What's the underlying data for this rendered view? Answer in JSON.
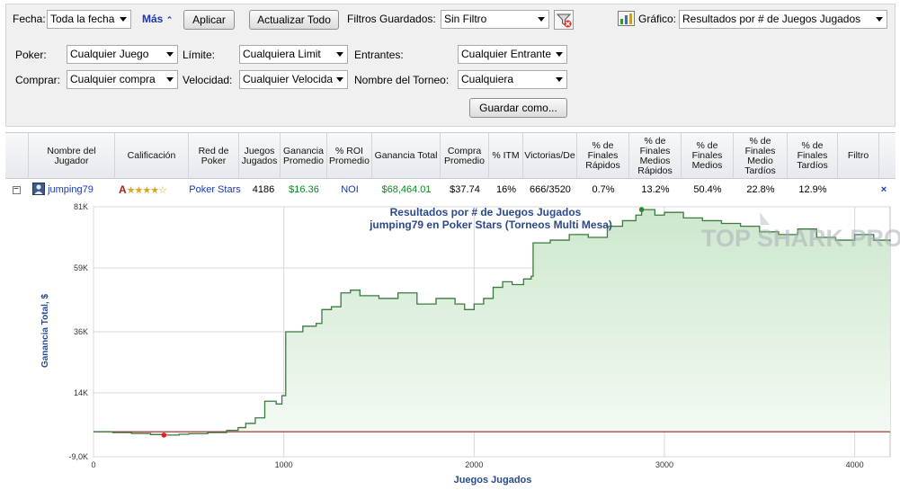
{
  "filters": {
    "fecha_label": "Fecha:",
    "fecha_value": "Toda la fecha",
    "mas_label": "Más",
    "aplicar_label": "Aplicar",
    "actualizar_label": "Actualizar Todo",
    "filtros_guardados_label": "Filtros Guardados:",
    "filtros_guardados_value": "Sin Filtro",
    "grafico_label": "Gráfico:",
    "grafico_value": "Resultados por # de Juegos Jugados",
    "poker_label": "Poker:",
    "poker_value": "Cualquier Juego",
    "limite_label": "Límite:",
    "limite_value": "Cualquiera Limit",
    "entrantes_label": "Entrantes:",
    "entrantes_value": "Cualquier Entrante",
    "comprar_label": "Comprar:",
    "comprar_value": "Cualquier compra",
    "velocidad_label": "Velocidad:",
    "velocidad_value": "Cualquier Velocida",
    "nombre_torneo_label": "Nombre del Torneo:",
    "nombre_torneo_value": "Cualquiera",
    "guardar_label": "Guardar como..."
  },
  "table": {
    "headers": {
      "nombre": "Nombre del Jugador",
      "calificacion": "Calificación",
      "red": "Red de Poker",
      "juegos": "Juegos Jugados",
      "ganancia_prom": "Ganancia Promedio",
      "roi": "% ROI Promedio",
      "ganancia_total": "Ganancia Total",
      "compra": "Compra Promedio",
      "itm": "% ITM",
      "victorias": "Victorias/De",
      "fin_rapidos": "% de Finales Rápidos",
      "fin_medios_rapidos": "% de Finales Medios Rápidos",
      "fin_medios": "% de Finales Medios",
      "fin_medio_tardios": "% de Finales Medio Tardíos",
      "fin_tardios": "% de Finales Tardíos",
      "filtro": "Filtro"
    },
    "row": {
      "player": "jumping79",
      "grade": "A",
      "stars": "★★★★☆",
      "network": "Poker Stars",
      "games": "4186",
      "avg_profit": "$16.36",
      "roi": "NOI",
      "total_profit": "$68,464.01",
      "avg_buyin": "$37.74",
      "itm": "16%",
      "wins": "666/3520",
      "fin_rapidos": "0.7%",
      "fin_medios_rapidos": "13.2%",
      "fin_medios": "50.4%",
      "fin_medio_tardios": "22.8%",
      "fin_tardios": "12.9%",
      "remove": "×",
      "collapse": "−"
    }
  },
  "chart_data": {
    "type": "area",
    "title": "Resultados por # de Juegos Jugados",
    "subtitle": "jumping79 en Poker Stars (Torneos Multi Mesa)",
    "xlabel": "Juegos Jugados",
    "ylabel": "Ganancia Total, $",
    "xlim": [
      0,
      4186
    ],
    "ylim": [
      -9000,
      81000
    ],
    "x_ticks": [
      0,
      1000,
      2000,
      3000,
      4000
    ],
    "x_tick_labels": [
      "0",
      "1000",
      "2000",
      "3000",
      "4000"
    ],
    "y_ticks": [
      -9000,
      14000,
      36000,
      59000,
      81000
    ],
    "y_tick_labels": [
      "-9,0K",
      "14K",
      "36K",
      "59K",
      "81K"
    ],
    "grid": true,
    "line_color": "#3d7a3d",
    "fill_color": "#dcefdc",
    "zero_line_color": "#a02020",
    "watermark": "TOP SHARK PRO",
    "x": [
      0,
      100,
      200,
      300,
      370,
      450,
      500,
      600,
      700,
      760,
      800,
      850,
      900,
      960,
      990,
      1010,
      1100,
      1170,
      1200,
      1250,
      1300,
      1350,
      1400,
      1500,
      1600,
      1700,
      1800,
      1900,
      1950,
      2000,
      2050,
      2100,
      2150,
      2200,
      2260,
      2300,
      2310,
      2400,
      2500,
      2600,
      2700,
      2780,
      2850,
      2880,
      2950,
      3000,
      3100,
      3200,
      3300,
      3400,
      3500,
      3600,
      3700,
      3800,
      3900,
      4000,
      4100,
      4186
    ],
    "y": [
      0,
      -300,
      -600,
      -1000,
      -1200,
      -900,
      -700,
      -300,
      500,
      1500,
      3000,
      5000,
      11000,
      10000,
      13000,
      36000,
      38000,
      39000,
      44000,
      45000,
      50000,
      51000,
      49000,
      48000,
      50000,
      46000,
      48000,
      46000,
      44000,
      46000,
      48000,
      52000,
      54000,
      53000,
      55000,
      56000,
      68000,
      69000,
      71000,
      70000,
      74000,
      76000,
      78000,
      80000,
      78000,
      79000,
      77000,
      76000,
      75000,
      74000,
      72000,
      71000,
      73000,
      70000,
      69000,
      71000,
      69000,
      68500
    ],
    "low_point": {
      "x": 370,
      "y": -1200
    },
    "high_point": {
      "x": 2880,
      "y": 80000
    }
  }
}
